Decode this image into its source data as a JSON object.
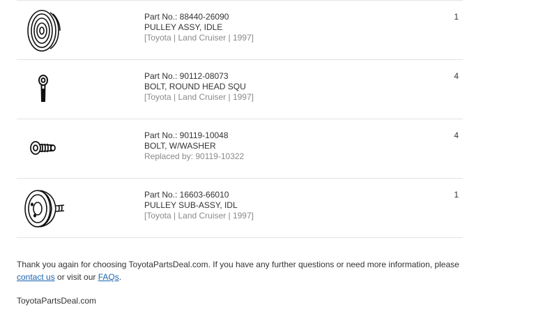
{
  "parts": [
    {
      "part_no": "Part No.: 88440-26090",
      "name": "PULLEY ASSY, IDLE",
      "sub": "[Toyota | Land Cruiser | 1997]",
      "qty": "1",
      "icon": "idler-pulley-icon"
    },
    {
      "part_no": "Part No.: 90112-08073",
      "name": "BOLT, ROUND HEAD SQU",
      "sub": "[Toyota | Land Cruiser | 1997]",
      "qty": "4",
      "icon": "round-head-bolt-icon"
    },
    {
      "part_no": "Part No.: 90119-10048",
      "name": "BOLT, W/WASHER",
      "sub": "Replaced by: 90119-10322",
      "qty": "4",
      "icon": "washer-bolt-icon"
    },
    {
      "part_no": "Part No.: 16603-66010",
      "name": "PULLEY SUB-ASSY, IDL",
      "sub": "[Toyota | Land Cruiser | 1997]",
      "qty": "1",
      "icon": "pulley-sub-assy-icon"
    }
  ],
  "footer": {
    "text_before": "Thank you again for choosing ToyotaPartsDeal.com. If you have any further questions or need more information, please ",
    "contact_link": "contact us",
    "text_middle": " or visit our ",
    "faq_link": "FAQs",
    "text_after": ".",
    "site": "ToyotaPartsDeal.com"
  },
  "colors": {
    "link": "#1a63b0",
    "muted": "#8a8a8a",
    "divider": "#e3e3e3"
  }
}
